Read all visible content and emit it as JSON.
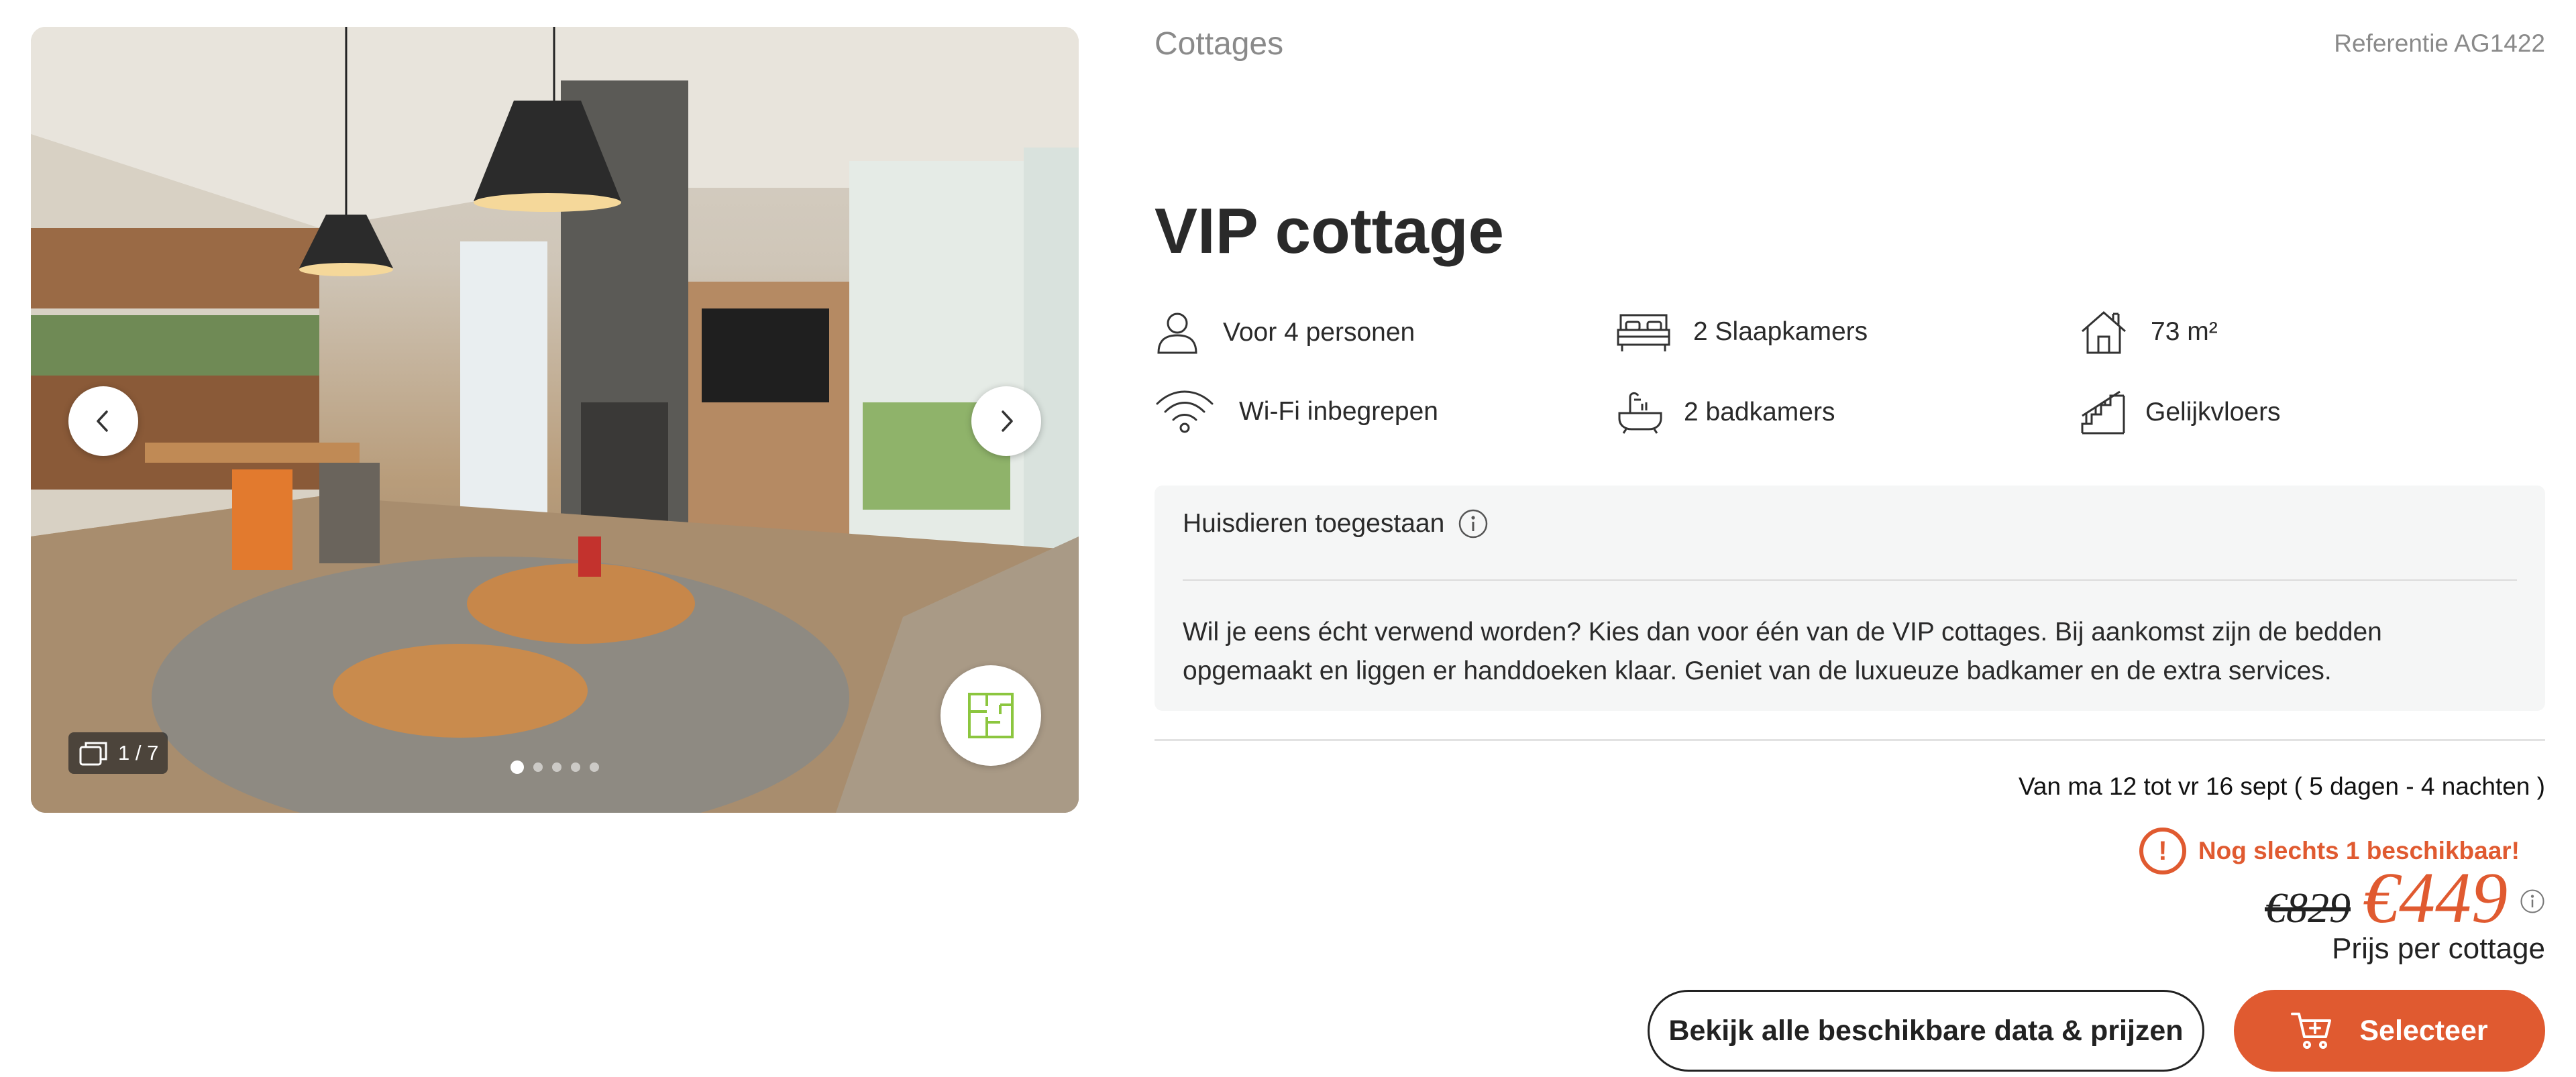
{
  "gallery": {
    "counter": "1 / 7",
    "dots_total": 5,
    "active_dot": 0
  },
  "header": {
    "category": "Cottages",
    "reference": "Referentie AG1422"
  },
  "title": "VIP cottage",
  "features": {
    "persons": "Voor 4 personen",
    "bedrooms": "2 Slaapkamers",
    "area": "73 m²",
    "wifi": "Wi-Fi inbegrepen",
    "bathrooms": "2 badkamers",
    "floor": "Gelijkvloers"
  },
  "info": {
    "pets": "Huisdieren toegestaan",
    "description": "Wil je eens écht verwend worden? Kies dan voor één van de VIP cottages. Bij aankomst zijn de bedden opgemaakt en liggen er handdoeken klaar. Geniet van de luxueuze badkamer en de extra services."
  },
  "booking": {
    "dates": "Van ma 12 tot vr 16 sept ( 5 dagen - 4 nachten )",
    "availability": "Nog slechts 1 beschikbaar!",
    "alert_symbol": "!",
    "old_price": "€829",
    "new_price": "€449",
    "per_unit": "Prijs per cottage",
    "all_dates_label": "Bekijk alle beschikbare data & prijzen",
    "select_label": "Selecteer"
  },
  "colors": {
    "accent": "#e05a30",
    "floorplan_icon": "#8cc63f",
    "panel_bg": "#f5f6f6"
  },
  "icons": [
    "chevron-left-icon",
    "chevron-right-icon",
    "gallery-stack-icon",
    "floorplan-icon",
    "person-icon",
    "bed-icon",
    "house-icon",
    "wifi-icon",
    "bathtub-icon",
    "stairs-icon",
    "info-icon",
    "alert-icon",
    "cart-icon"
  ]
}
